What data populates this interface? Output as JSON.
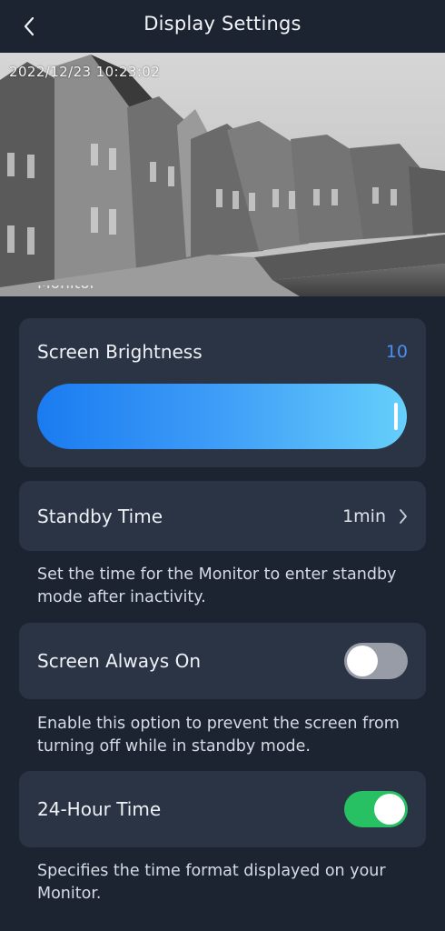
{
  "header": {
    "title": "Display Settings",
    "back_icon": "chevron-left-icon"
  },
  "preview": {
    "timestamp": "2022/12/23 10:23:02",
    "section_label": "Monitor"
  },
  "brightness": {
    "label": "Screen Brightness",
    "value": "10",
    "level_fraction": 1.0,
    "accent_color": "#4d8ff0"
  },
  "standby": {
    "label": "Standby Time",
    "value": "1min",
    "chevron_icon": "chevron-right-icon",
    "description": "Set the time for the Monitor to enter standby mode after inactivity."
  },
  "always_on": {
    "label": "Screen Always On",
    "enabled": false,
    "description": "Enable this option to prevent the screen from turning off while in standby mode."
  },
  "hour24": {
    "label": "24-Hour Time",
    "enabled": true,
    "on_color": "#27c163",
    "description": "Specifies the time format displayed on your Monitor."
  }
}
